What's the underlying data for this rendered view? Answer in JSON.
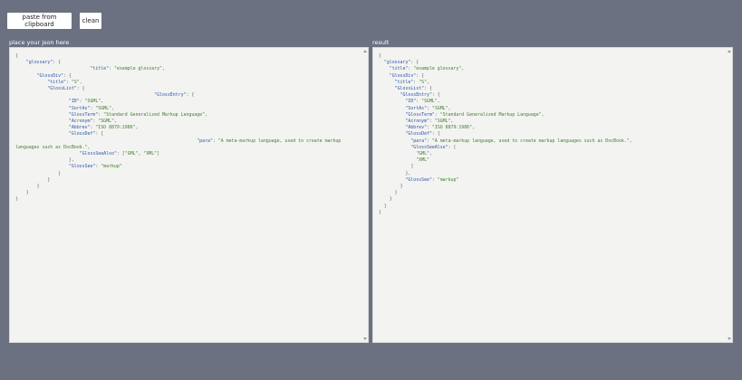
{
  "toolbar": {
    "paste_label": "paste from clipboard",
    "clean_label": "clean"
  },
  "left": {
    "label": "place your json here"
  },
  "right": {
    "label": "result"
  },
  "colors": {
    "background": "#6b7180",
    "pane": "#f3f3f1",
    "key": "#2a56a8",
    "string": "#3f7f2f"
  }
}
